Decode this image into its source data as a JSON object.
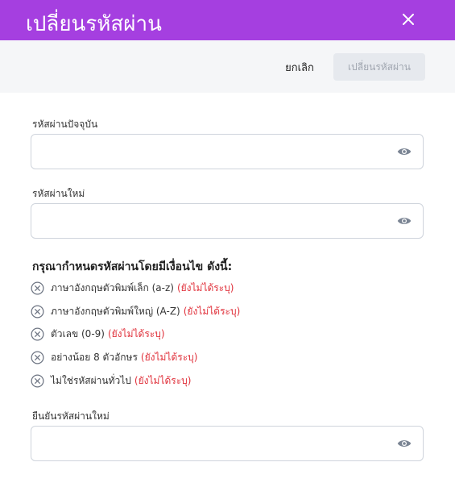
{
  "dialog": {
    "title": "เปลี่ยนรหัสผ่าน",
    "close_icon": "close-icon"
  },
  "toolbar": {
    "cancel_label": "ยกเลิก",
    "submit_label": "เปลี่ยนรหัสผ่าน"
  },
  "fields": {
    "current": {
      "label": "รหัสผ่านปัจจุบัน",
      "value": "",
      "icon": "eye-icon"
    },
    "new": {
      "label": "รหัสผ่านใหม่",
      "value": "",
      "icon": "eye-icon"
    },
    "confirm": {
      "label": "ยืนยันรหัสผ่านใหม่",
      "value": "",
      "icon": "eye-icon"
    }
  },
  "requirements": {
    "title": "กรุณากำหนดรหัสผ่านโดยมีเงื่อนไข ดังนี้:",
    "status_color": "#e0303a",
    "items": [
      {
        "text": "ภาษาอังกฤษตัวพิมพ์เล็ก (a-z)",
        "status": "(ยังไม่ได้ระบุ)"
      },
      {
        "text": "ภาษาอังกฤษตัวพิมพ์ใหญ่ (A-Z)",
        "status": "(ยังไม่ได้ระบุ)"
      },
      {
        "text": "ตัวเลข (0-9)",
        "status": "(ยังไม่ได้ระบุ)"
      },
      {
        "text": "อย่างน้อย 8 ตัวอักษร",
        "status": "(ยังไม่ได้ระบุ)"
      },
      {
        "text": "ไม่ใช่รหัสผ่านทั่วไป",
        "status": "(ยังไม่ได้ระบุ)"
      }
    ]
  },
  "colors": {
    "header_bg": "#a53fe0",
    "toolbar_bg": "#f5f6f8"
  }
}
